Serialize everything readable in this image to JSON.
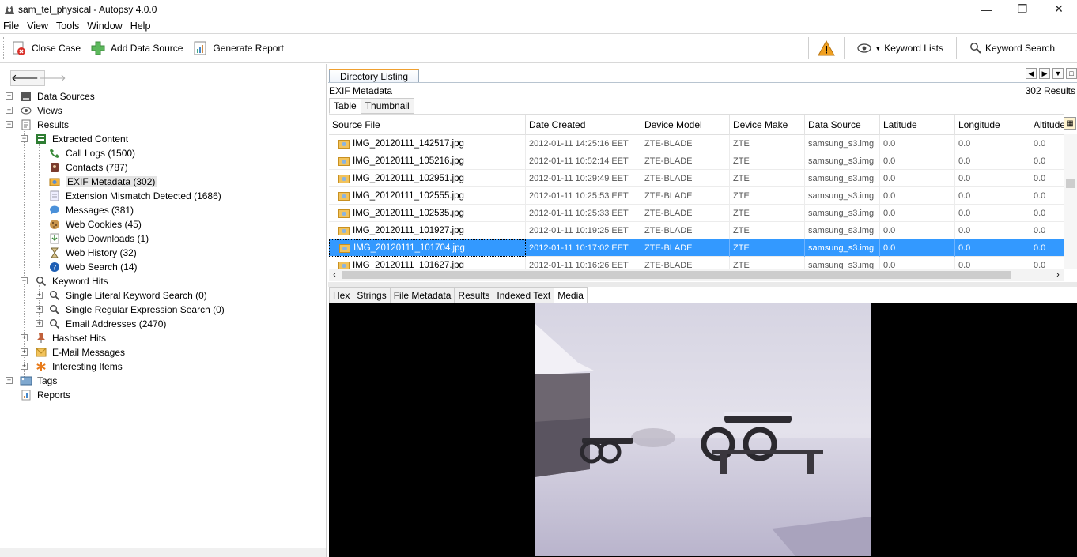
{
  "window": {
    "title": "sam_tel_physical - Autopsy 4.0.0",
    "minimize_glyph": "—",
    "restore_glyph": "❐",
    "close_glyph": "✕"
  },
  "menu": [
    "File",
    "View",
    "Tools",
    "Window",
    "Help"
  ],
  "toolbar": {
    "close_case": "Close Case",
    "add_data_source": "Add Data Source",
    "generate_report": "Generate Report",
    "keyword_lists": "Keyword Lists",
    "keyword_search": "Keyword Search"
  },
  "nav": {
    "back": "🡐",
    "forward": "🡒"
  },
  "tree": {
    "data_sources": "Data Sources",
    "views": "Views",
    "results": "Results",
    "extracted_content": "Extracted Content",
    "call_logs": "Call Logs (1500)",
    "contacts": "Contacts (787)",
    "exif_metadata": "EXIF Metadata (302)",
    "extension_mismatch": "Extension Mismatch Detected (1686)",
    "messages": "Messages (381)",
    "web_cookies": "Web Cookies (45)",
    "web_downloads": "Web Downloads (1)",
    "web_history": "Web History (32)",
    "web_search": "Web Search (14)",
    "keyword_hits": "Keyword Hits",
    "single_literal": "Single Literal Keyword Search (0)",
    "single_regex": "Single Regular Expression Search (0)",
    "email_addresses": "Email Addresses (2470)",
    "hashset_hits": "Hashset Hits",
    "email_messages": "E-Mail Messages",
    "interesting_items": "Interesting Items",
    "tags": "Tags",
    "reports": "Reports"
  },
  "directory": {
    "tab_label": "Directory Listing",
    "title": "EXIF Metadata",
    "results_count": "302  Results",
    "subtabs": [
      "Table",
      "Thumbnail"
    ]
  },
  "table": {
    "columns": [
      "Source File",
      "Date Created",
      "Device Model",
      "Device Make",
      "Data Source",
      "Latitude",
      "Longitude",
      "Altitude"
    ],
    "rows": [
      [
        "IMG_20120111_142517.jpg",
        "2012-01-11 14:25:16 EET",
        "ZTE-BLADE",
        "ZTE",
        "samsung_s3.img",
        "0.0",
        "0.0",
        "0.0"
      ],
      [
        "IMG_20120111_105216.jpg",
        "2012-01-11 10:52:14 EET",
        "ZTE-BLADE",
        "ZTE",
        "samsung_s3.img",
        "0.0",
        "0.0",
        "0.0"
      ],
      [
        "IMG_20120111_102951.jpg",
        "2012-01-11 10:29:49 EET",
        "ZTE-BLADE",
        "ZTE",
        "samsung_s3.img",
        "0.0",
        "0.0",
        "0.0"
      ],
      [
        "IMG_20120111_102555.jpg",
        "2012-01-11 10:25:53 EET",
        "ZTE-BLADE",
        "ZTE",
        "samsung_s3.img",
        "0.0",
        "0.0",
        "0.0"
      ],
      [
        "IMG_20120111_102535.jpg",
        "2012-01-11 10:25:33 EET",
        "ZTE-BLADE",
        "ZTE",
        "samsung_s3.img",
        "0.0",
        "0.0",
        "0.0"
      ],
      [
        "IMG_20120111_101927.jpg",
        "2012-01-11 10:19:25 EET",
        "ZTE-BLADE",
        "ZTE",
        "samsung_s3.img",
        "0.0",
        "0.0",
        "0.0"
      ],
      [
        "IMG_20120111_101704.jpg",
        "2012-01-11 10:17:02 EET",
        "ZTE-BLADE",
        "ZTE",
        "samsung_s3.img",
        "0.0",
        "0.0",
        "0.0"
      ],
      [
        "IMG_20120111_101627.jpg",
        "2012-01-11 10:16:26 EET",
        "ZTE-BLADE",
        "ZTE",
        "samsung_s3.img",
        "0.0",
        "0.0",
        "0.0"
      ]
    ],
    "selected_row": 6
  },
  "viewer_tabs": [
    "Hex",
    "Strings",
    "File Metadata",
    "Results",
    "Indexed Text",
    "Media"
  ],
  "colors": {
    "selection": "#3399ff",
    "warning": "#f0a020",
    "tab_accent": "#f0a030"
  },
  "icons": {
    "warning": "warning-icon",
    "eye": "eye-icon",
    "search": "search-icon"
  }
}
